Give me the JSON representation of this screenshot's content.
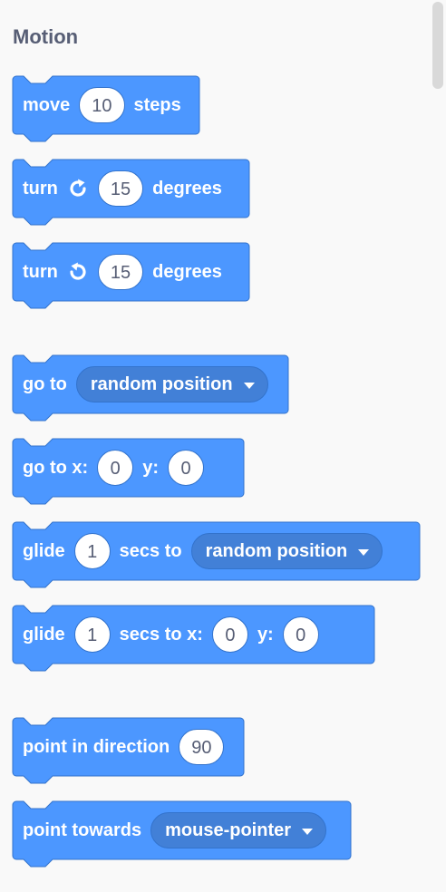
{
  "category": {
    "title": "Motion"
  },
  "colors": {
    "block_fill": "#4c97ff",
    "block_stroke": "#3373cc",
    "dropdown_fill": "#4280d7",
    "input_text": "#575e75",
    "category_title": "#575e75",
    "background": "#f9f9f9"
  },
  "blocks": {
    "move": {
      "label_before": "move",
      "steps_value": "10",
      "label_after": "steps"
    },
    "turn_right": {
      "label_before": "turn",
      "icon": "rotate-right-icon",
      "degrees_value": "15",
      "label_after": "degrees"
    },
    "turn_left": {
      "label_before": "turn",
      "icon": "rotate-left-icon",
      "degrees_value": "15",
      "label_after": "degrees"
    },
    "go_to": {
      "label_before": "go to",
      "target_value": "random position"
    },
    "go_to_xy": {
      "label_before": "go to x:",
      "x_value": "0",
      "label_y": "y:",
      "y_value": "0"
    },
    "glide_to": {
      "label_before": "glide",
      "secs_value": "1",
      "label_mid": "secs to",
      "target_value": "random position"
    },
    "glide_xy": {
      "label_before": "glide",
      "secs_value": "1",
      "label_mid": "secs to x:",
      "x_value": "0",
      "label_y": "y:",
      "y_value": "0"
    },
    "point_direction": {
      "label_before": "point in direction",
      "direction_value": "90"
    },
    "point_towards": {
      "label_before": "point towards",
      "target_value": "mouse-pointer"
    }
  }
}
